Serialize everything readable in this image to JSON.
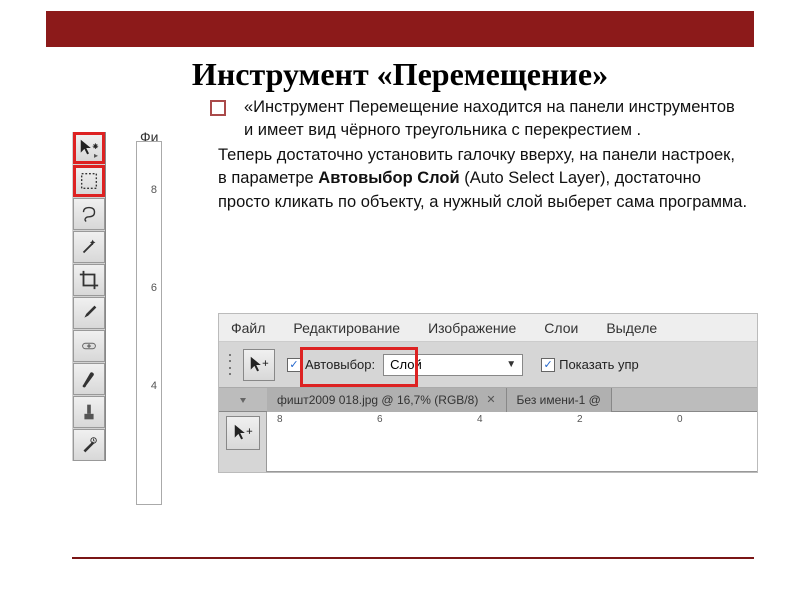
{
  "title": "Инструмент «Перемещение»",
  "body": {
    "p1": "«Инструмент  Перемещение находится на панели инструментов и имеет вид чёрного треугольника с перекрестием .",
    "p2a": "Теперь достаточно установить галочку вверху, на панели настроек, в параметре ",
    "p2b": "Автовыбор Слой",
    "p2c": " (Auto Select Layer), достаточно просто кликать по объекту, а нужный слой выберет сама программа."
  },
  "ruler_top_label": "Фи",
  "vruler": [
    "8",
    "6",
    "4"
  ],
  "menu": [
    "Файл",
    "Редактирование",
    "Изображение",
    "Слои",
    "Выделе"
  ],
  "optbar": {
    "autoselect_label": "Автовыбор:",
    "dropdown_value": "Слой",
    "show_ctrls_label": "Показать упр"
  },
  "tabs": [
    {
      "label": "фишт2009 018.jpg @ 16,7% (RGB/8)"
    },
    {
      "label": "Без имени-1 @"
    }
  ],
  "hruler": [
    "8",
    "6",
    "4",
    "2",
    "0"
  ],
  "tools": [
    "move",
    "marquee",
    "lasso",
    "wand",
    "crop",
    "eyedropper",
    "heal",
    "brush",
    "stamp",
    "history"
  ]
}
